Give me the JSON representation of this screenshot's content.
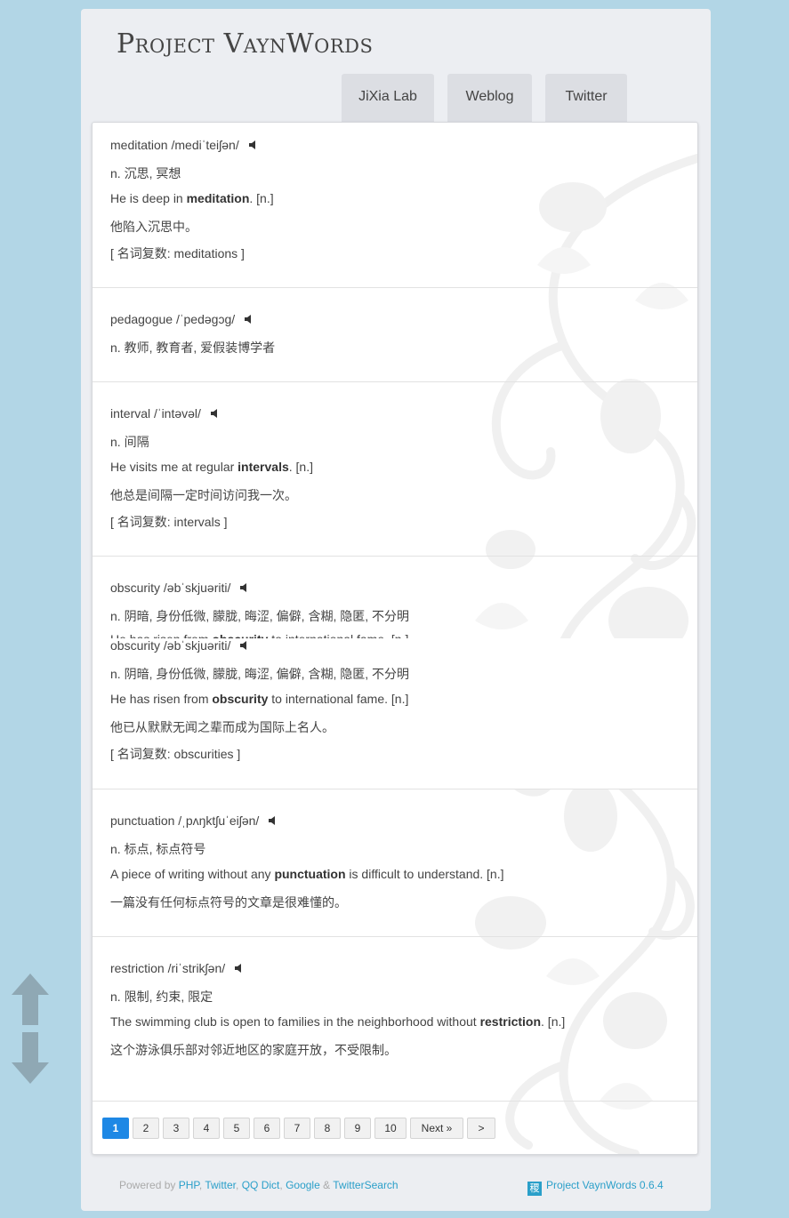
{
  "site": {
    "title": "Project VaynWords"
  },
  "nav": [
    {
      "label": "JiXia Lab"
    },
    {
      "label": "Weblog"
    },
    {
      "label": "Twitter"
    }
  ],
  "entries": [
    {
      "word": "meditation /mediˈteiʃən/",
      "definition": "n. 沉思, 冥想",
      "example_pre": "He is deep in ",
      "example_bold": "meditation",
      "example_post": ". [n.]",
      "translation": "他陷入沉思中。",
      "plural": "[ 名词复数: meditations ]"
    },
    {
      "word": "pedagogue /ˈpedəgɔg/",
      "definition": "n. 教师, 教育者, 爱假装博学者"
    },
    {
      "word": "interval /ˈintəvəl/",
      "definition": "n. 间隔",
      "example_pre": "He visits me at regular ",
      "example_bold": "intervals",
      "example_post": ". [n.]",
      "translation": "他总是间隔一定时间访问我一次。",
      "plural": "[ 名词复数: intervals ]"
    },
    {
      "word": "obscurity /əbˈskjuəriti/",
      "definition": "n. 阴暗, 身份低微, 朦胧, 晦涩, 偏僻, 含糊, 隐匿, 不分明",
      "example_pre": "He has risen from ",
      "example_bold": "obscurity",
      "example_post": " to international fame. [n.]",
      "translation": "他已从默默无闻之辈而成为国际上名人。",
      "plural": "[ 名词复数: obscurities ]"
    },
    {
      "word": "punctuation /ˌpʌŋktʃuˈeiʃən/",
      "definition": "n. 标点, 标点符号",
      "example_pre": "A piece of writing without any ",
      "example_bold": "punctuation",
      "example_post": " is difficult to understand. [n.]",
      "translation": "一篇没有任何标点符号的文章是很难懂的。"
    },
    {
      "word": "restriction /riˈstrikʃən/",
      "definition": "n. 限制, 约束, 限定",
      "example_pre": "The swimming club is open to families in the neighborhood without ",
      "example_bold": "restriction",
      "example_post": ". [n.]",
      "translation": "这个游泳俱乐部对邻近地区的家庭开放，不受限制。"
    }
  ],
  "pagination": {
    "pages": [
      "1",
      "2",
      "3",
      "4",
      "5",
      "6",
      "7",
      "8",
      "9",
      "10"
    ],
    "current": "1",
    "next": "Next »",
    "last": ">"
  },
  "footer": {
    "powered_by": "Powered by",
    "links": [
      "PHP",
      "Twitter",
      "QQ Dict",
      "Google",
      "TwitterSearch"
    ],
    "sep": ",",
    "amp": "&",
    "badge": "稷",
    "version": "Project VaynWords 0.6.4"
  },
  "icons": {
    "speaker": "speaker-icon",
    "scroll_up": "arrow-up-icon",
    "scroll_down": "arrow-down-icon"
  },
  "colors": {
    "background": "#b2d6e6",
    "page": "#eceef2",
    "pager_active": "#1e88e5",
    "link": "#2a9fc9"
  }
}
